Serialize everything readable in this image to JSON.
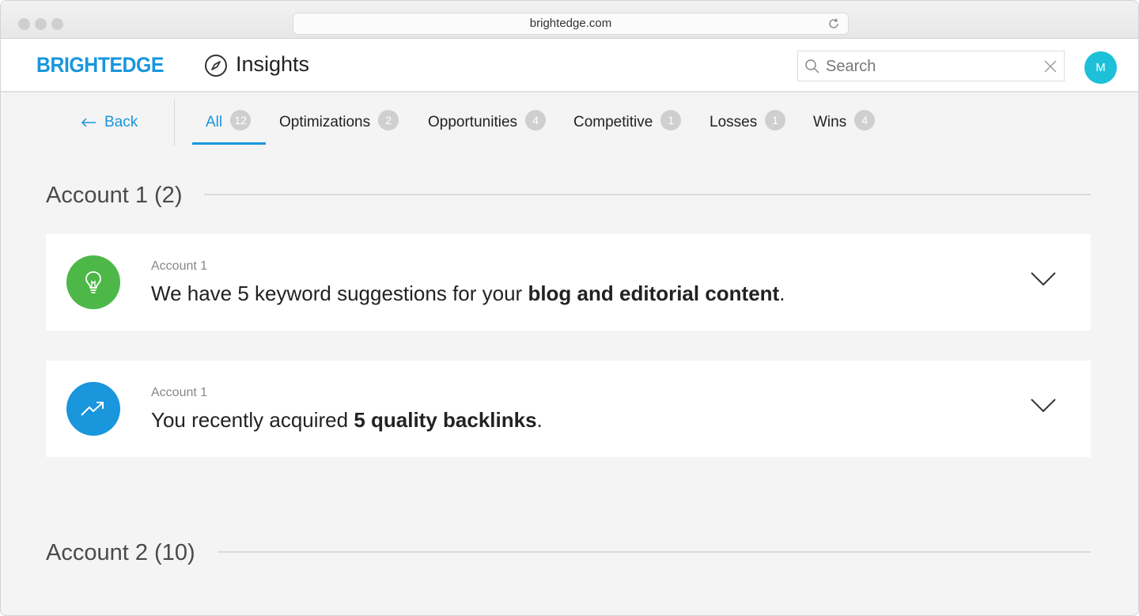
{
  "browser": {
    "url": "brightedge.com"
  },
  "header": {
    "logo": "BRIGHTEDGE",
    "title": "Insights",
    "search_placeholder": "Search",
    "avatar_initial": "M"
  },
  "nav": {
    "back_label": "Back",
    "tabs": [
      {
        "label": "All",
        "count": "12",
        "active": true
      },
      {
        "label": "Optimizations",
        "count": "2"
      },
      {
        "label": "Opportunities",
        "count": "4"
      },
      {
        "label": "Competitive",
        "count": "1"
      },
      {
        "label": "Losses",
        "count": "1"
      },
      {
        "label": "Wins",
        "count": "4"
      }
    ]
  },
  "sections": [
    {
      "title": "Account 1 (2)",
      "cards": [
        {
          "account": "Account 1",
          "text_before": "We have 5 keyword suggestions for your ",
          "text_bold": "blog and editorial content",
          "text_after": ".",
          "icon": "lightbulb-icon",
          "icon_color": "#4db848"
        },
        {
          "account": "Account 1",
          "text_before": "You recently acquired ",
          "text_bold": "5 quality backlinks",
          "text_after": ".",
          "icon": "trending-up-icon",
          "icon_color": "#1996dc"
        }
      ]
    },
    {
      "title": "Account 2 (10)"
    }
  ],
  "colors": {
    "accent": "#1996dc",
    "badge": "#cfcfcf",
    "avatar": "#1cc0d8"
  }
}
